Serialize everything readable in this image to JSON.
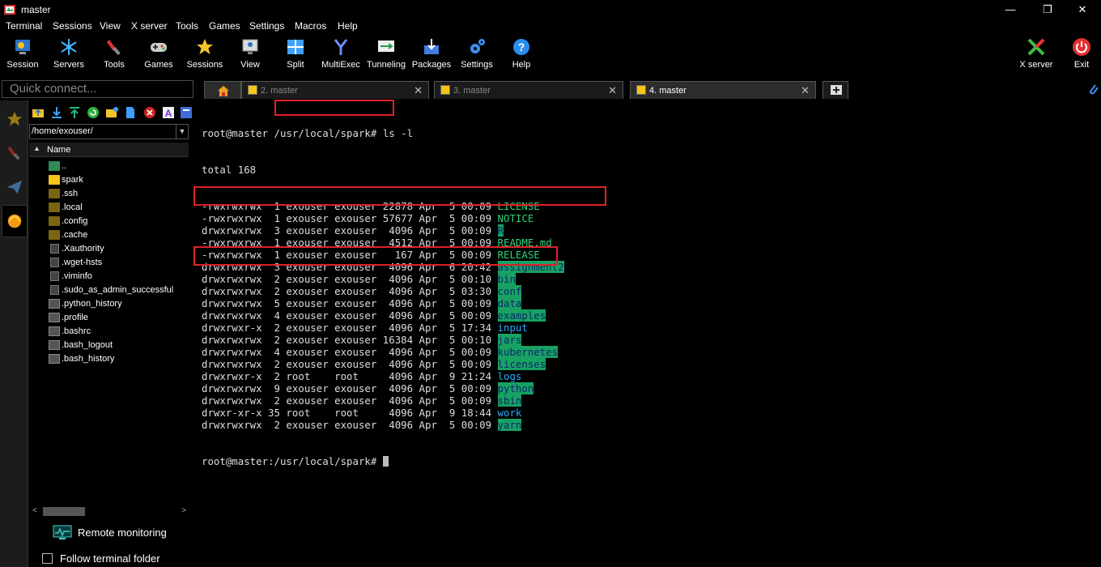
{
  "window": {
    "title": "master",
    "minimize": "—",
    "restore": "❐",
    "close": "✕"
  },
  "menu": [
    "Terminal",
    "Sessions",
    "View",
    "X server",
    "Tools",
    "Games",
    "Settings",
    "Macros",
    "Help"
  ],
  "toolbar": {
    "session": "Session",
    "servers": "Servers",
    "tools": "Tools",
    "games": "Games",
    "sessions": "Sessions",
    "view": "View",
    "split": "Split",
    "multiexec": "MultiExec",
    "tunneling": "Tunneling",
    "packages": "Packages",
    "settings": "Settings",
    "help": "Help",
    "xserver": "X server",
    "exit": "Exit"
  },
  "quick_connect": {
    "placeholder": "Quick connect..."
  },
  "sftp": {
    "path": "/home/exouser/",
    "column_name": "Name",
    "files": [
      {
        "name": "..",
        "kind": "up"
      },
      {
        "name": "spark",
        "kind": "folder"
      },
      {
        "name": ".ssh",
        "kind": "hidden"
      },
      {
        "name": ".local",
        "kind": "hidden"
      },
      {
        "name": ".config",
        "kind": "hidden"
      },
      {
        "name": ".cache",
        "kind": "hidden"
      },
      {
        "name": ".Xauthority",
        "kind": "doc"
      },
      {
        "name": ".wget-hsts",
        "kind": "doc"
      },
      {
        "name": ".viminfo",
        "kind": "doc"
      },
      {
        "name": ".sudo_as_admin_successful",
        "kind": "doc"
      },
      {
        "name": ".python_history",
        "kind": "doc2"
      },
      {
        "name": ".profile",
        "kind": "doc2"
      },
      {
        "name": ".bashrc",
        "kind": "doc2"
      },
      {
        "name": ".bash_logout",
        "kind": "doc2"
      },
      {
        "name": ".bash_history",
        "kind": "doc2"
      }
    ],
    "remote_monitoring": "Remote monitoring",
    "follow_terminal_folder": "Follow terminal folder"
  },
  "tabs": [
    {
      "label": "2. master",
      "active": false
    },
    {
      "label": "3. master",
      "active": false
    },
    {
      "label": "4. master",
      "active": true
    }
  ],
  "terminal": {
    "prompt_user": "root@master",
    "prompt_path": "/usr/local/spark#",
    "command": " ls -l",
    "total": "total 168",
    "entries": [
      {
        "meta": "-rwxrwxrwx  1 exouser exouser 22878 Apr  5 00:09 ",
        "name": "LICENSE",
        "style": "green"
      },
      {
        "meta": "-rwxrwxrwx  1 exouser exouser 57677 Apr  5 00:09 ",
        "name": "NOTICE",
        "style": "green"
      },
      {
        "meta": "drwxrwxrwx  3 exouser exouser  4096 Apr  5 00:09 ",
        "name": "R",
        "style": "dir"
      },
      {
        "meta": "-rwxrwxrwx  1 exouser exouser  4512 Apr  5 00:09 ",
        "name": "README.md",
        "style": "green"
      },
      {
        "meta": "-rwxrwxrwx  1 exouser exouser   167 Apr  5 00:09 ",
        "name": "RELEASE",
        "style": "green"
      },
      {
        "meta": "drwxrwxrwx  3 exouser exouser  4096 Apr  6 20:42 ",
        "name": "assignment2",
        "style": "dir"
      },
      {
        "meta": "drwxrwxrwx  2 exouser exouser  4096 Apr  5 00:10 ",
        "name": "bin",
        "style": "dir"
      },
      {
        "meta": "drwxrwxrwx  2 exouser exouser  4096 Apr  5 03:30 ",
        "name": "conf",
        "style": "dir"
      },
      {
        "meta": "drwxrwxrwx  5 exouser exouser  4096 Apr  5 00:09 ",
        "name": "data",
        "style": "dir"
      },
      {
        "meta": "drwxrwxrwx  4 exouser exouser  4096 Apr  5 00:09 ",
        "name": "examples",
        "style": "dir"
      },
      {
        "meta": "drwxrwxr-x  2 exouser exouser  4096 Apr  5 17:34 ",
        "name": "input",
        "style": "blue"
      },
      {
        "meta": "drwxrwxrwx  2 exouser exouser 16384 Apr  5 00:10 ",
        "name": "jars",
        "style": "dir"
      },
      {
        "meta": "drwxrwxrwx  4 exouser exouser  4096 Apr  5 00:09 ",
        "name": "kubernetes",
        "style": "dir"
      },
      {
        "meta": "drwxrwxrwx  2 exouser exouser  4096 Apr  5 00:09 ",
        "name": "licenses",
        "style": "dir"
      },
      {
        "meta": "drwxrwxr-x  2 root    root     4096 Apr  9 21:24 ",
        "name": "logs",
        "style": "blue"
      },
      {
        "meta": "drwxrwxrwx  9 exouser exouser  4096 Apr  5 00:09 ",
        "name": "python",
        "style": "dir"
      },
      {
        "meta": "drwxrwxrwx  2 exouser exouser  4096 Apr  5 00:09 ",
        "name": "sbin",
        "style": "dir"
      },
      {
        "meta": "drwxr-xr-x 35 root    root     4096 Apr  9 18:44 ",
        "name": "work",
        "style": "blue"
      },
      {
        "meta": "drwxrwxrwx  2 exouser exouser  4096 Apr  5 00:09 ",
        "name": "yarn",
        "style": "dir"
      }
    ],
    "final_prompt": "root@master:/usr/local/spark# "
  },
  "colors": {
    "highlight_box": "#e0202a",
    "dir_bg": "#17a162",
    "exec_green": "#2fd37a",
    "dir_blue": "#29a9ff"
  }
}
